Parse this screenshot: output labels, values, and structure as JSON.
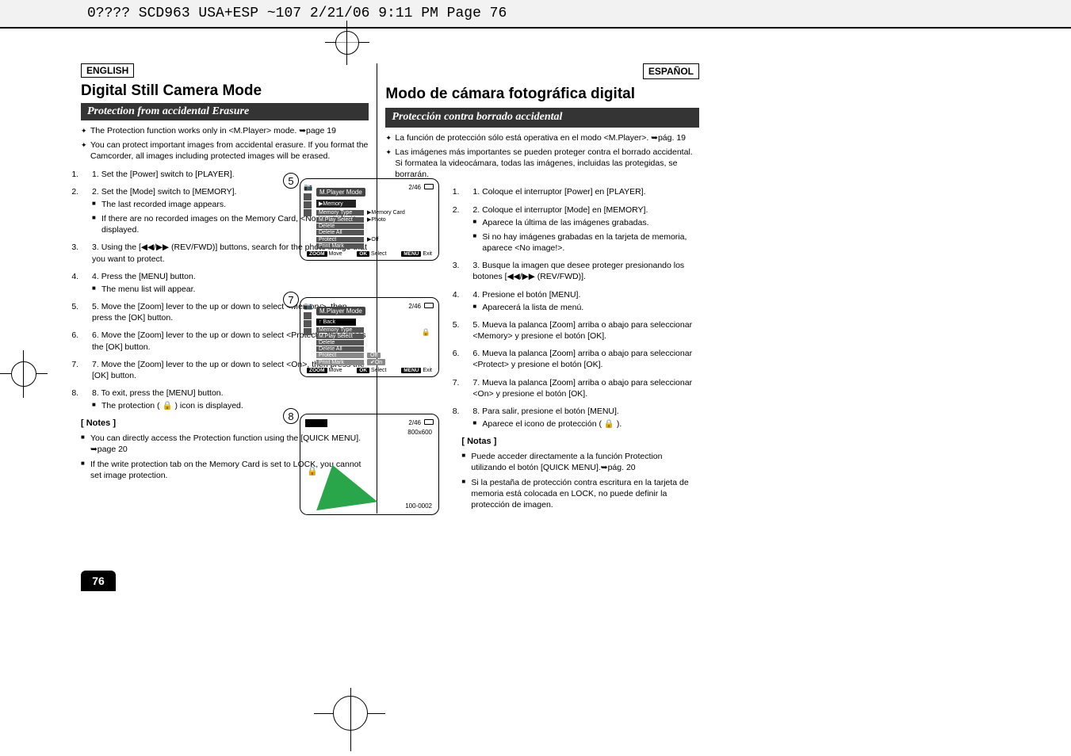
{
  "header": {
    "jobline": "0???? SCD963 USA+ESP ~107  2/21/06 9:11 PM  Page 76"
  },
  "page_number": "76",
  "left": {
    "lang": "ENGLISH",
    "title": "Digital Still Camera Mode",
    "subtitle": "Protection from accidental Erasure",
    "intro": [
      "The Protection function works only in <M.Player> mode. ➥page 19",
      "You can protect important images from accidental erasure. If you format the Camcorder, all images including protected images will be erased."
    ],
    "steps": [
      "Set the [Power] switch to [PLAYER].",
      "Set the [Mode] switch to [MEMORY].",
      "Using the [◀◀/▶▶ (REV/FWD)] buttons, search for the photo image that you want to protect.",
      "Press the [MENU] button.",
      "Move the [Zoom] lever to the up or down to select <Memory>, then press the [OK] button.",
      "Move the [Zoom] lever to the up or down to select <Protect>, then press the [OK] button.",
      "Move the [Zoom] lever to the up or down to select <On>, then press the [OK] button.",
      "To exit, press the [MENU] button."
    ],
    "step2_sub": [
      "The last recorded image appears.",
      "If there are no recorded images on the Memory Card, <No image!> is displayed."
    ],
    "step4_sub": [
      "The menu list will appear."
    ],
    "step8_sub": [
      "The protection ( 🔒 ) icon is displayed."
    ],
    "notes_h": "[ Notes ]",
    "notes": [
      "You can directly access the Protection function using the [QUICK MENU]. ➥page 20",
      "If the write protection tab on the Memory Card is set to LOCK, you cannot set image protection."
    ]
  },
  "right": {
    "lang": "ESPAÑOL",
    "title": "Modo de cámara fotográfica digital",
    "subtitle": "Protección contra borrado accidental",
    "intro": [
      "La función de protección sólo está operativa en el modo <M.Player>. ➥pág. 19",
      "Las imágenes más importantes se pueden proteger contra el borrado accidental. Si formatea la videocámara, todas las imágenes, incluidas las protegidas, se borrarán."
    ],
    "steps": [
      "Coloque el interruptor [Power] en [PLAYER].",
      "Coloque el interruptor [Mode] en [MEMORY].",
      "Busque la imagen que desee proteger presionando los botones [◀◀/▶▶ (REV/FWD)].",
      "Presione el botón [MENU].",
      "Mueva la palanca [Zoom] arriba o abajo para seleccionar <Memory> y presione el botón [OK].",
      "Mueva la palanca [Zoom] arriba o abajo para seleccionar <Protect> y presione el botón [OK].",
      "Mueva la palanca [Zoom] arriba o abajo para seleccionar <On> y presione el botón [OK].",
      "Para salir, presione el botón [MENU]."
    ],
    "step2_sub": [
      "Aparece la última de las imágenes grabadas.",
      "Si no hay imágenes grabadas en la tarjeta de memoria, aparece <No image!>."
    ],
    "step4_sub": [
      "Aparecerá la lista de menú."
    ],
    "step8_sub": [
      "Aparece el icono de protección ( 🔒 )."
    ],
    "notes_h": "[ Notas ]",
    "notes": [
      "Puede acceder directamente a la función Protection utilizando el botón [QUICK MENU].➥pág. 20",
      "Si la pestaña de protección contra escritura en la tarjeta de memoria está colocada en LOCK, no puede definir la protección de imagen."
    ]
  },
  "lcd": {
    "fig5": "5",
    "fig7": "7",
    "fig8": "8",
    "p1": {
      "title": "M.Player Mode",
      "counter": "2/46",
      "memory_row": "▶Memory",
      "items": [
        {
          "label": "Memory Type",
          "value": "▶Memory Card"
        },
        {
          "label": "M.Play Select",
          "value": "▶Photo"
        },
        {
          "label": "Delete",
          "value": ""
        },
        {
          "label": "Delete All",
          "value": ""
        },
        {
          "label": "Protect",
          "value": "▶Off"
        },
        {
          "label": "Print Mark",
          "value": ""
        }
      ],
      "footer": {
        "move": "Move",
        "select": "Select",
        "exit": "Exit",
        "zoom": "ZOOM",
        "ok": "OK",
        "menu": "MENU"
      }
    },
    "p2": {
      "title": "M.Player Mode",
      "counter": "2/46",
      "back": "Back",
      "items": [
        {
          "label": "Memory Type",
          "value": ""
        },
        {
          "label": "M.Play Select",
          "value": ""
        },
        {
          "label": "Delete",
          "value": ""
        },
        {
          "label": "Delete All",
          "value": ""
        },
        {
          "label": "Protect",
          "value": "Off",
          "hi": true
        },
        {
          "label": "Print Mark",
          "value": "✔On",
          "pill": true
        }
      ],
      "lock_icon": "🔒",
      "footer": {
        "move": "Move",
        "select": "Select",
        "exit": "Exit",
        "zoom": "ZOOM",
        "ok": "OK",
        "menu": "MENU"
      }
    },
    "p3": {
      "counter": "2/46",
      "res": "800x600",
      "idx": "100-0002"
    }
  }
}
